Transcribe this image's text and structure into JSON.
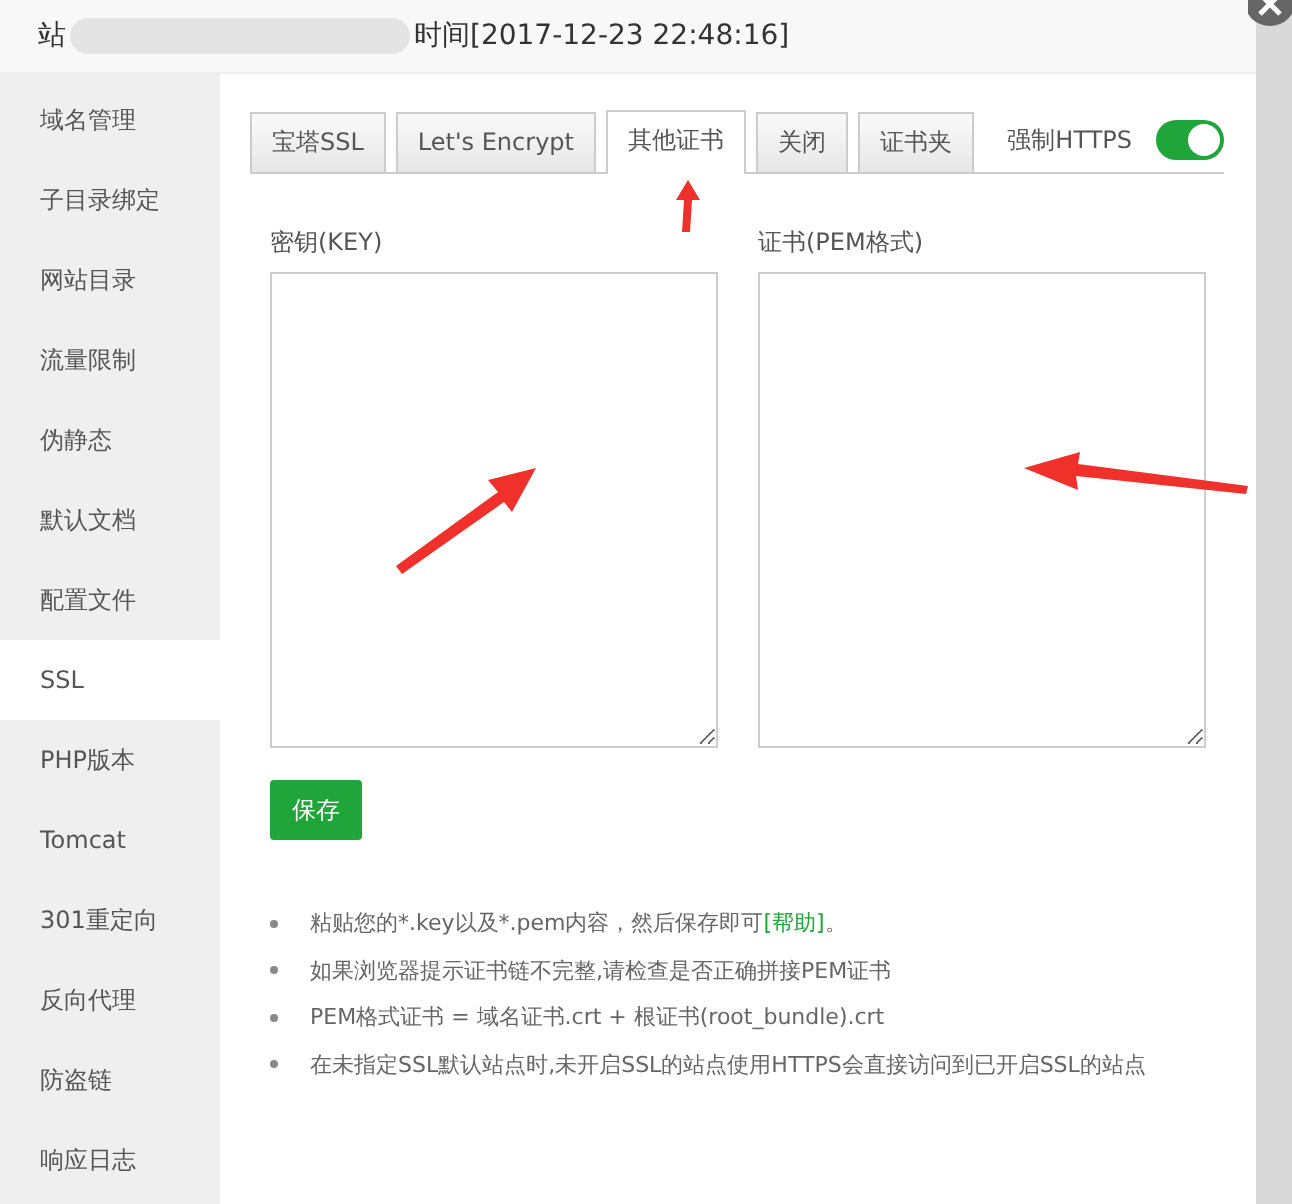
{
  "window": {
    "title_start": "站",
    "title": "时间[2017-12-23 22:48:16]"
  },
  "sidebar": {
    "items": [
      {
        "label": "域名管理",
        "selected": false
      },
      {
        "label": "子目录绑定",
        "selected": false
      },
      {
        "label": "网站目录",
        "selected": false
      },
      {
        "label": "流量限制",
        "selected": false
      },
      {
        "label": "伪静态",
        "selected": false
      },
      {
        "label": "默认文档",
        "selected": false
      },
      {
        "label": "配置文件",
        "selected": false
      },
      {
        "label": "SSL",
        "selected": true
      },
      {
        "label": "PHP版本",
        "selected": false
      },
      {
        "label": "Tomcat",
        "selected": false
      },
      {
        "label": "301重定向",
        "selected": false
      },
      {
        "label": "反向代理",
        "selected": false
      },
      {
        "label": "防盗链",
        "selected": false
      },
      {
        "label": "响应日志",
        "selected": false
      }
    ]
  },
  "tabs": [
    {
      "label": "宝塔SSL",
      "selected": false
    },
    {
      "label": "Let's Encrypt",
      "selected": false
    },
    {
      "label": "其他证书",
      "selected": true
    },
    {
      "label": "关闭",
      "selected": false
    },
    {
      "label": "证书夹",
      "selected": false
    }
  ],
  "force_https": {
    "label": "强制HTTPS",
    "on": true
  },
  "fields": [
    {
      "label": "密钥(KEY)"
    },
    {
      "label": "证书(PEM格式)"
    }
  ],
  "save_button": "保存",
  "tips": [
    {
      "text": "粘贴您的*.key以及*.pem内容，然后保存即可",
      "link": "[帮助]",
      "after": "。"
    },
    {
      "text": "如果浏览器提示证书链不完整,请检查是否正确拼接PEM证书"
    },
    {
      "text": "PEM格式证书 = 域名证书.crt + 根证书(root_bundle).crt"
    },
    {
      "text": "在未指定SSL默认站点时,未开启SSL的站点使用HTTPS会直接访问到已开启SSL的站点"
    }
  ]
}
